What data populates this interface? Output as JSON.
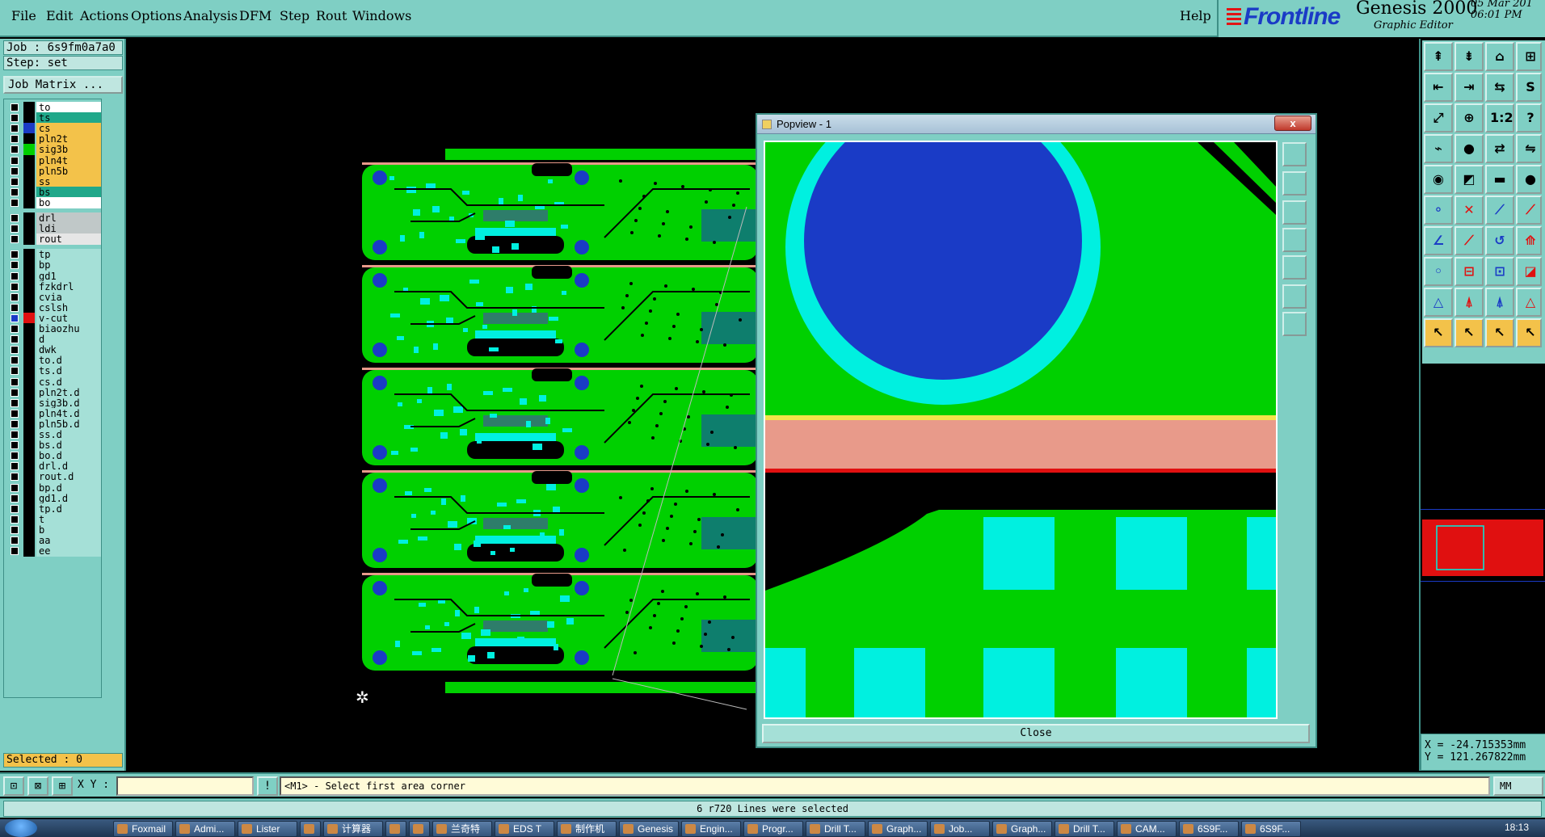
{
  "menu": {
    "items": [
      "File",
      "Edit",
      "Actions",
      "Options",
      "Analysis",
      "DFM",
      "Step",
      "Rout",
      "Windows"
    ],
    "help": "Help"
  },
  "brand": {
    "logo": "Frontline",
    "title": "Genesis 2000",
    "subtitle": "Graphic Editor",
    "date": "05 Mar 201",
    "time": "06:01 PM"
  },
  "left_panel": {
    "job": "Job : 6s9fm0a7a0",
    "step": "Step: set",
    "job_matrix": "Job Matrix ...",
    "selected": "Selected : 0",
    "layers": [
      {
        "name": "to",
        "bg": "#ffffff",
        "swatch": "#000000"
      },
      {
        "name": "ts",
        "bg": "#20a88a",
        "swatch": "#000000"
      },
      {
        "name": "cs",
        "bg": "#f3c24a",
        "swatch": "#1a3bc6"
      },
      {
        "name": "pln2t",
        "bg": "#f3c24a",
        "swatch": "#000000"
      },
      {
        "name": "sig3b",
        "bg": "#f3c24a",
        "swatch": "#00d000"
      },
      {
        "name": "pln4t",
        "bg": "#f3c24a",
        "swatch": "#000000"
      },
      {
        "name": "pln5b",
        "bg": "#f3c24a",
        "swatch": "#000000"
      },
      {
        "name": "ss",
        "bg": "#f3c24a",
        "swatch": "#000000"
      },
      {
        "name": "bs",
        "bg": "#20a88a",
        "swatch": "#000000"
      },
      {
        "name": "bo",
        "bg": "#ffffff",
        "swatch": "#000000"
      },
      {
        "name": "drl",
        "bg": "#c0c8c8",
        "swatch": "#000000",
        "gap": true
      },
      {
        "name": "ldi",
        "bg": "#c0c8c8",
        "swatch": "#000000"
      },
      {
        "name": "rout",
        "bg": "#e6e6e6",
        "swatch": "#000000"
      },
      {
        "name": "tp",
        "bg": "#a5e0d7",
        "swatch": "#000000",
        "gap": true
      },
      {
        "name": "bp",
        "bg": "#a5e0d7",
        "swatch": "#000000"
      },
      {
        "name": "gd1",
        "bg": "#a5e0d7",
        "swatch": "#000000"
      },
      {
        "name": "fzkdrl",
        "bg": "#a5e0d7",
        "swatch": "#000000"
      },
      {
        "name": "cvia",
        "bg": "#a5e0d7",
        "swatch": "#000000"
      },
      {
        "name": "cslsh",
        "bg": "#a5e0d7",
        "swatch": "#000000"
      },
      {
        "name": "v-cut",
        "bg": "#a5e0d7",
        "swatch": "#e01010",
        "active": true
      },
      {
        "name": "biaozhu",
        "bg": "#a5e0d7",
        "swatch": "#000000"
      },
      {
        "name": "d",
        "bg": "#a5e0d7",
        "swatch": "#000000"
      },
      {
        "name": "dwk",
        "bg": "#a5e0d7",
        "swatch": "#000000"
      },
      {
        "name": "to.d",
        "bg": "#a5e0d7",
        "swatch": "#000000"
      },
      {
        "name": "ts.d",
        "bg": "#a5e0d7",
        "swatch": "#000000"
      },
      {
        "name": "cs.d",
        "bg": "#a5e0d7",
        "swatch": "#000000"
      },
      {
        "name": "pln2t.d",
        "bg": "#a5e0d7",
        "swatch": "#000000"
      },
      {
        "name": "sig3b.d",
        "bg": "#a5e0d7",
        "swatch": "#000000"
      },
      {
        "name": "pln4t.d",
        "bg": "#a5e0d7",
        "swatch": "#000000"
      },
      {
        "name": "pln5b.d",
        "bg": "#a5e0d7",
        "swatch": "#000000"
      },
      {
        "name": "ss.d",
        "bg": "#a5e0d7",
        "swatch": "#000000"
      },
      {
        "name": "bs.d",
        "bg": "#a5e0d7",
        "swatch": "#000000"
      },
      {
        "name": "bo.d",
        "bg": "#a5e0d7",
        "swatch": "#000000"
      },
      {
        "name": "drl.d",
        "bg": "#a5e0d7",
        "swatch": "#000000"
      },
      {
        "name": "rout.d",
        "bg": "#a5e0d7",
        "swatch": "#000000"
      },
      {
        "name": "bp.d",
        "bg": "#a5e0d7",
        "swatch": "#000000"
      },
      {
        "name": "gd1.d",
        "bg": "#a5e0d7",
        "swatch": "#000000"
      },
      {
        "name": "tp.d",
        "bg": "#a5e0d7",
        "swatch": "#000000"
      },
      {
        "name": "t",
        "bg": "#a5e0d7",
        "swatch": "#000000"
      },
      {
        "name": "b",
        "bg": "#a5e0d7",
        "swatch": "#000000"
      },
      {
        "name": "aa",
        "bg": "#a5e0d7",
        "swatch": "#000000"
      },
      {
        "name": "ee",
        "bg": "#a5e0d7",
        "swatch": "#000000"
      }
    ]
  },
  "popview": {
    "title": "Popview - 1",
    "close_x": "x",
    "close_button": "Close"
  },
  "coords": {
    "x": "X = -24.715353mm",
    "y": "Y = 121.267822mm"
  },
  "command": {
    "xy_label": "X Y :",
    "prompt": "<M1> - Select first area corner",
    "units": "MM"
  },
  "status": {
    "message": "6 r720 Lines were selected"
  },
  "taskbar": {
    "items": [
      "Foxmail",
      "Admi...",
      "Lister",
      "",
      "计算器",
      "",
      "",
      "兰奇特",
      "EDS T",
      "制作机",
      "Genesis",
      "Engin...",
      "Progr...",
      "Drill T...",
      "Graph...",
      "Job...",
      "Graph...",
      "Drill T...",
      "CAM...",
      "6S9F...",
      "6S9F..."
    ],
    "clock": "18:13"
  },
  "colors": {
    "panel": "#7fcfc4",
    "copper": "#00d000",
    "pad_blue": "#1a3bc6",
    "cyan": "#00f0e0",
    "vcut": "#e01010"
  }
}
